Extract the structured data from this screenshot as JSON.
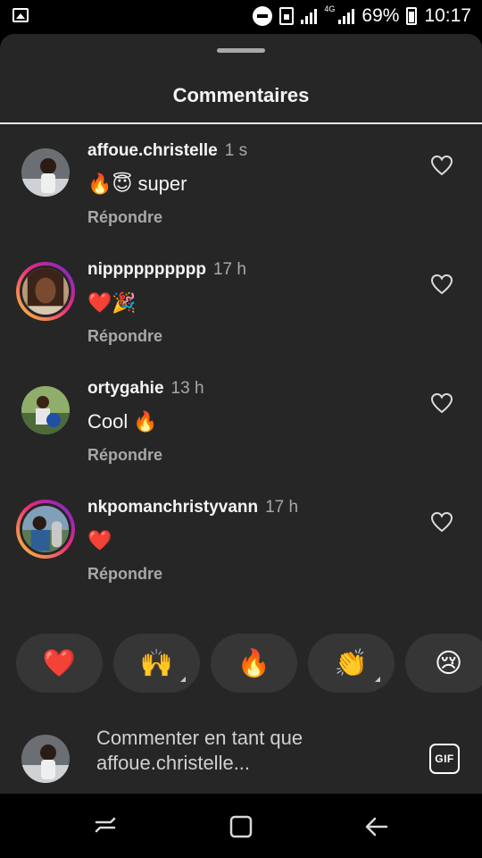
{
  "status_bar": {
    "battery": "69%",
    "network": "4G",
    "time": "10:17"
  },
  "sheet": {
    "title": "Commentaires"
  },
  "comments": [
    {
      "username": "affoue.christelle",
      "time": "1 s",
      "text": "🔥😇 super",
      "reply": "Répondre",
      "story_ring": false
    },
    {
      "username": "nipppppppppp",
      "time": "17 h",
      "text": "❤️🎉",
      "reply": "Répondre",
      "story_ring": true
    },
    {
      "username": "ortygahie",
      "time": "13 h",
      "text": "Cool 🔥",
      "reply": "Répondre",
      "story_ring": false
    },
    {
      "username": "nkpomanchristyvann",
      "time": "17 h",
      "text": "❤️",
      "reply": "Répondre",
      "story_ring": true
    }
  ],
  "reactions": [
    {
      "emoji": "❤️",
      "has_menu": false
    },
    {
      "emoji": "🙌",
      "has_menu": true
    },
    {
      "emoji": "🔥",
      "has_menu": false
    },
    {
      "emoji": "👏",
      "has_menu": true
    },
    {
      "emoji": "😢",
      "has_menu": false
    }
  ],
  "composer": {
    "placeholder": "Commenter en tant que affoue.christelle...",
    "gif_label": "GIF"
  },
  "colors": {
    "sheet_background": "#262626",
    "chip_background": "#363636",
    "secondary_text": "#a8a8a8",
    "story_ring": "#ee2a7b"
  }
}
